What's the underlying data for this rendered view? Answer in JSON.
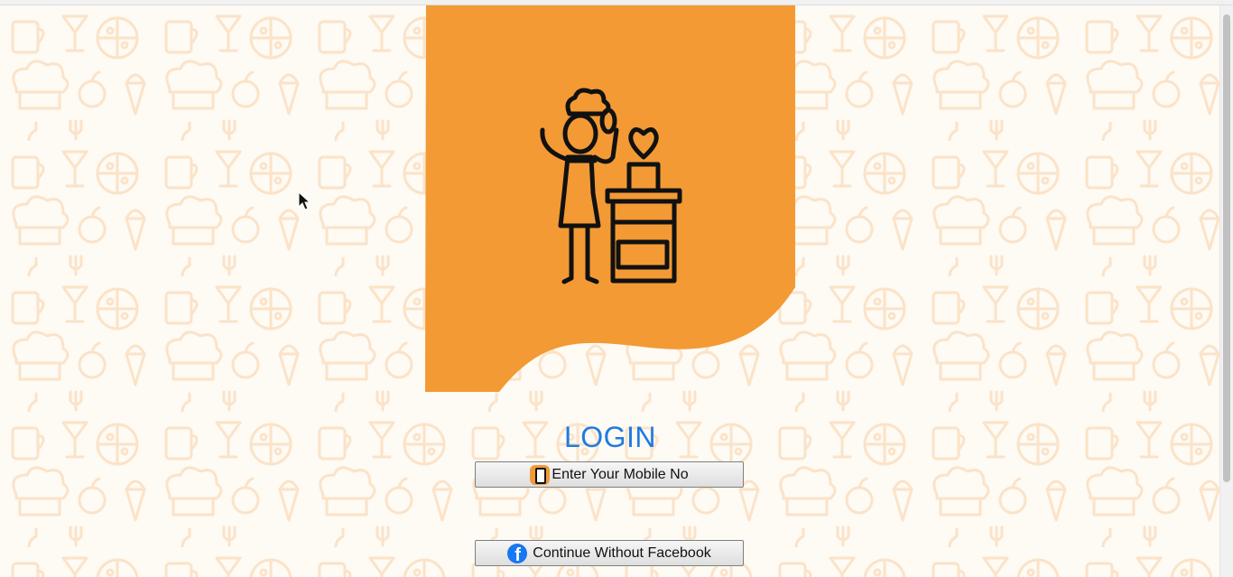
{
  "login": {
    "title": "LOGIN",
    "mobile_button_label": "Enter Your Mobile No",
    "facebook_button_label": "Continue Without Facebook"
  },
  "icons": {
    "hero": "chef-cooking-icon",
    "mobile": "mobile-phone-icon",
    "facebook": "facebook-icon"
  },
  "colors": {
    "accent_orange": "#f39a35",
    "title_blue": "#1e7be2",
    "pattern_tint": "#fbe6cf",
    "facebook_blue": "#1877f2"
  }
}
